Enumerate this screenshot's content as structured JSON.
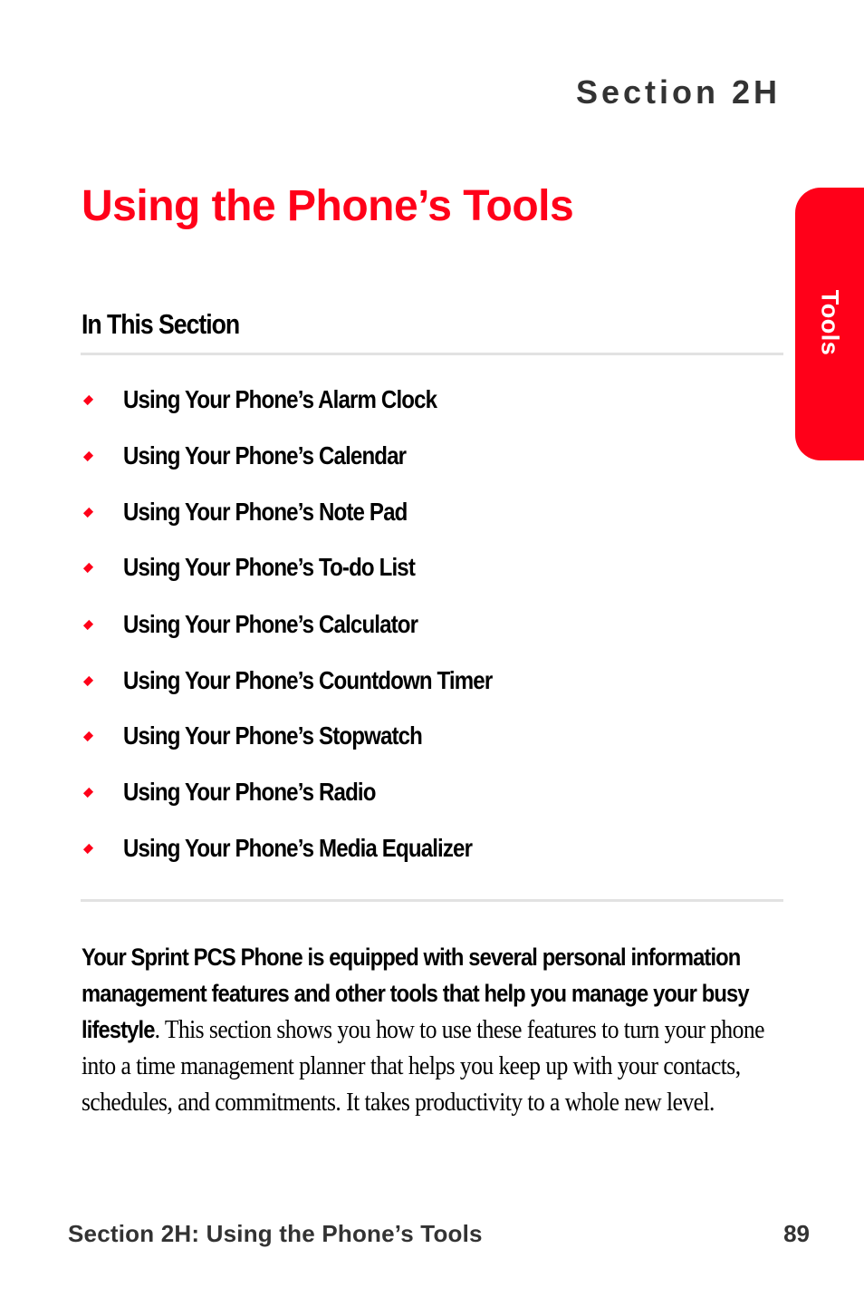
{
  "header": {
    "section_label": "Section 2H",
    "title": "Using the Phone’s Tools"
  },
  "side_tab": {
    "label": "Tools",
    "color": "#ff0019"
  },
  "in_this_section": {
    "heading": "In This Section",
    "items": [
      {
        "label": "Using Your Phone’s Alarm Clock"
      },
      {
        "label": "Using Your Phone’s Calendar"
      },
      {
        "label": "Using Your Phone’s Note Pad"
      },
      {
        "label": "Using Your Phone’s To-do List"
      },
      {
        "label": "Using Your Phone’s Calculator"
      },
      {
        "label": "Using Your Phone’s Countdown Timer"
      },
      {
        "label": "Using Your Phone’s Stopwatch"
      },
      {
        "label": "Using Your Phone’s Radio"
      },
      {
        "label": "Using Your Phone’s Media Equalizer"
      }
    ]
  },
  "intro": {
    "lead": "Your Sprint PCS Phone is equipped with several personal information management features and other tools that help you manage your busy lifestyle",
    "body": ". This section shows you how to use these features to turn your phone into a time management planner that helps you keep up with your contacts, schedules, and commitments. It takes productivity to a whole new level."
  },
  "footer": {
    "section_title": "Section 2H: Using the Phone’s Tools",
    "page_number": "89"
  },
  "colors": {
    "accent": "#ff0019",
    "heading_gray": "#333333",
    "rule": "#e2e2e2"
  }
}
